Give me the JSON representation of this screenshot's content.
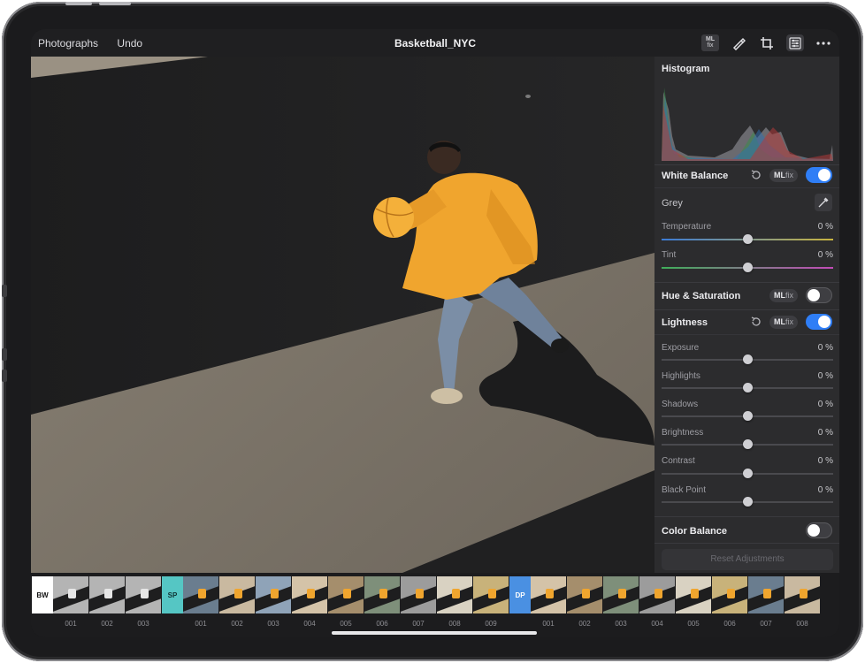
{
  "topbar": {
    "back_label": "Photographs",
    "undo_label": "Undo",
    "title": "Basketball_NYC",
    "ml_badge_line1": "ML",
    "ml_badge_line2": "fix",
    "icons": [
      "ml-fix-icon",
      "brush-icon",
      "crop-icon",
      "adjustments-icon",
      "more-icon"
    ]
  },
  "panel": {
    "histogram_title": "Histogram",
    "white_balance": {
      "title": "White Balance",
      "mlfix_bold": "ML",
      "mlfix_rest": "fix",
      "enabled": true,
      "grey_label": "Grey",
      "temperature_label": "Temperature",
      "temperature_value": "0 %",
      "temperature_level": 0.5,
      "tint_label": "Tint",
      "tint_value": "0 %",
      "tint_level": 0.5
    },
    "hue_saturation": {
      "title": "Hue & Saturation",
      "mlfix_bold": "ML",
      "mlfix_rest": "fix",
      "enabled": false
    },
    "lightness": {
      "title": "Lightness",
      "mlfix_bold": "ML",
      "mlfix_rest": "fix",
      "enabled": true,
      "sliders": [
        {
          "label": "Exposure",
          "value": "0 %",
          "level": 0.5
        },
        {
          "label": "Highlights",
          "value": "0 %",
          "level": 0.5
        },
        {
          "label": "Shadows",
          "value": "0 %",
          "level": 0.5
        },
        {
          "label": "Brightness",
          "value": "0 %",
          "level": 0.5
        },
        {
          "label": "Contrast",
          "value": "0 %",
          "level": 0.5
        },
        {
          "label": "Black Point",
          "value": "0 %",
          "level": 0.5
        }
      ]
    },
    "color_balance": {
      "title": "Color Balance",
      "enabled": false
    },
    "reset_label": "Reset Adjustments"
  },
  "filmstrip": {
    "groups": [
      {
        "tag": "BW",
        "tag_bg": "#ffffff",
        "tag_fg": "#111111",
        "numbers": [
          "001",
          "002",
          "003"
        ]
      },
      {
        "tag": "SP",
        "tag_bg": "#55c6c4",
        "tag_fg": "#0f3333",
        "numbers": [
          "001",
          "002",
          "003",
          "004",
          "005",
          "006",
          "007",
          "008",
          "009"
        ]
      },
      {
        "tag": "DP",
        "tag_bg": "#4a90e2",
        "tag_fg": "#ffffff",
        "numbers": [
          "001",
          "002",
          "003",
          "004",
          "005",
          "006",
          "007",
          "008"
        ]
      }
    ]
  },
  "colors": {
    "accent": "#2f7ef6",
    "jacket": "#f0a52e"
  }
}
